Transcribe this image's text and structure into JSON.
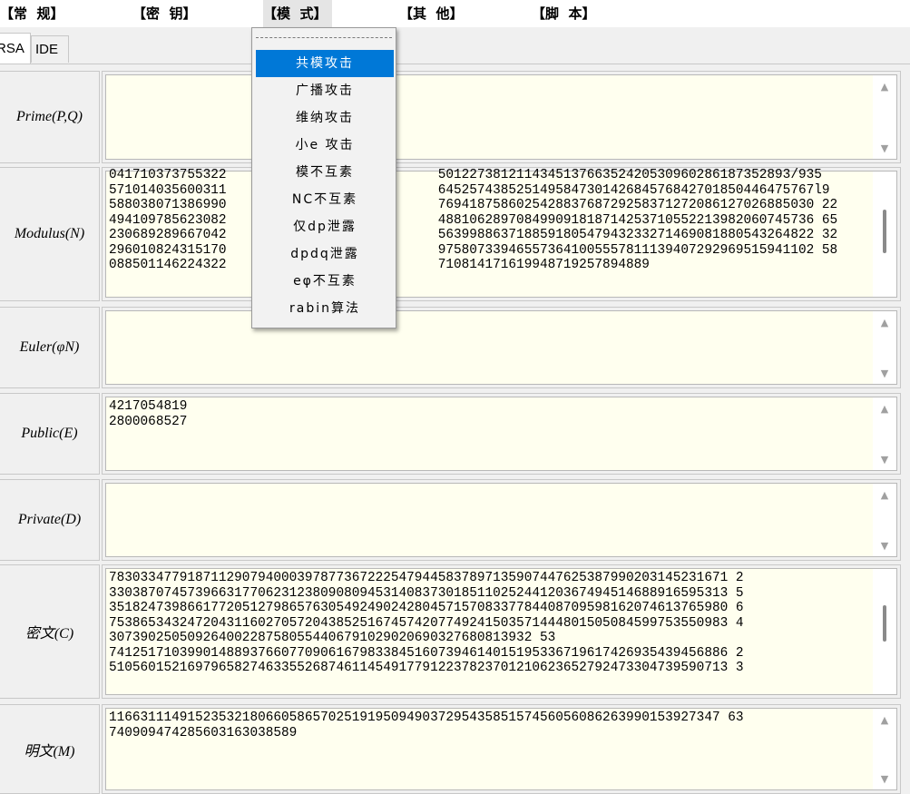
{
  "menubar": {
    "items": [
      "【常  规】",
      "【密  钥】",
      "【模  式】",
      "【其  他】",
      "【脚  本】"
    ]
  },
  "tabs": {
    "items": [
      "RSA",
      "IDE"
    ],
    "selected": "RSA"
  },
  "fields": {
    "prime": {
      "label": "Prime(P,Q)",
      "value": ""
    },
    "modulus": {
      "label": "Modulus(N)",
      "value": "041710373755322                           501227381211434513766352420530960286187352893/935\n571014035600311                           645257438525149584730142684576842701850446475767l9\n588038071386990                           769418758602542883768729258371272086127026885030 22\n494109785623082                           488106289708499091818714253710552213982060745736 65\n230689289667042                           563998863718859180547943233271469081880543264822 32\n296010824315170                           975807339465573641005557811139407292969515941102 58\n088501146224322                           710814171619948719257894889"
    },
    "euler": {
      "label": "Euler(φN)",
      "value": ""
    },
    "public": {
      "label": "Public(E)",
      "value": "4217054819\n2800068527"
    },
    "private": {
      "label": "Private(D)",
      "value": ""
    },
    "cipher": {
      "label": "密文(C)",
      "value": "7830334779187112907940003978773672225479445837897135907447625387990203145231671 2\n3303870745739663177062312380908094531408373018511025244120367494514688916595313 5\n3518247398661772051279865763054924902428045715708337784408709598162074613765980 6\n7538653432472043116027057204385251674574207749241503571444801505084599753550983 4\n307390250509264002287580554406791029020690327680813932 53\n7412517103990148893766077090616798338451607394614015195336719617426935439456886 2\n5105601521697965827463355268746114549177912237823701210623652792473304739590713 3"
    },
    "plain": {
      "label": "明文(M)",
      "value": "116631114915235321806605865702519195094903729543585157456056086263990153927347 63\n740909474285603163038589"
    }
  },
  "dropdown": {
    "items": [
      "共模攻击",
      "广播攻击",
      "维纳攻击",
      "小e 攻击",
      "模不互素",
      "NC不互素",
      "仅dp泄露",
      "dpdq泄露",
      "eφ不互素",
      "rabin算法"
    ],
    "highlighted": "共模攻击"
  },
  "colors": {
    "field_bg": "#ffffef",
    "highlight": "#0078d7"
  }
}
